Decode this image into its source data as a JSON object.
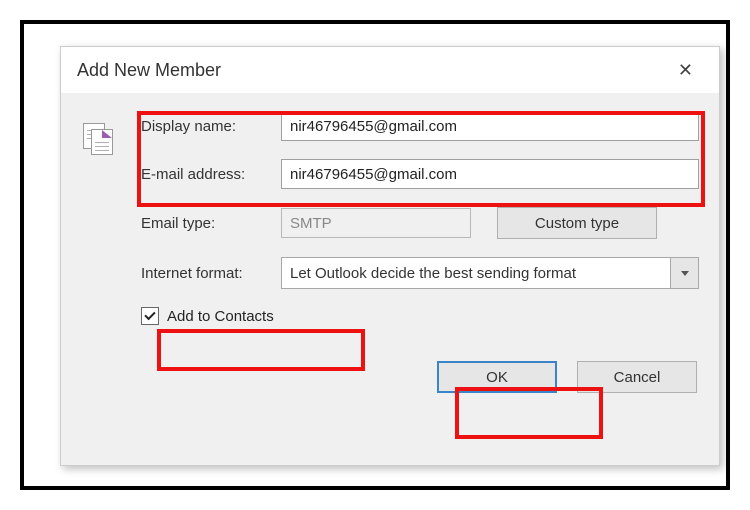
{
  "dialog": {
    "title": "Add New Member"
  },
  "labels": {
    "display_name": "Display name:",
    "email_address": "E-mail address:",
    "email_type": "Email type:",
    "internet_format": "Internet format:",
    "add_to_contacts": "Add to Contacts"
  },
  "values": {
    "display_name": "nir46796455@gmail.com",
    "email_address": "nir46796455@gmail.com",
    "email_type": "SMTP",
    "internet_format_selected": "Let Outlook decide the best sending format"
  },
  "buttons": {
    "custom_type": "Custom type",
    "ok": "OK",
    "cancel": "Cancel"
  },
  "checkbox": {
    "add_to_contacts_checked": true
  }
}
